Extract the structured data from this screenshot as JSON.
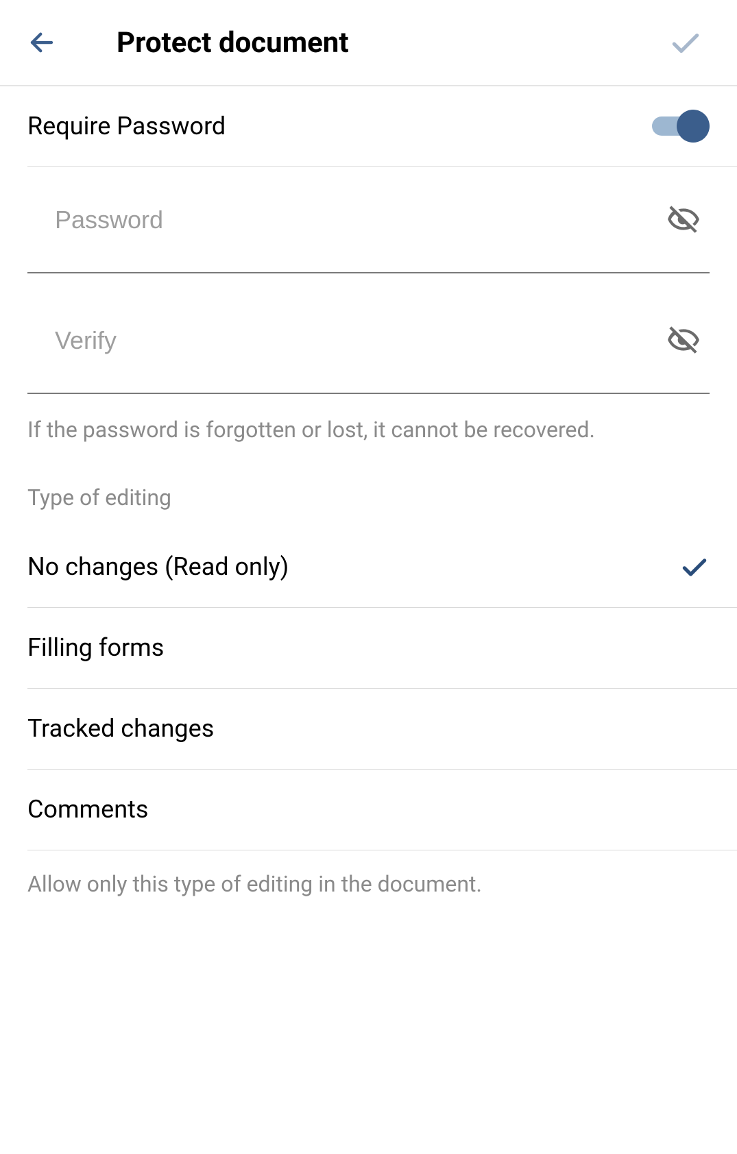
{
  "header": {
    "title": "Protect document"
  },
  "requirePassword": {
    "label": "Require Password",
    "enabled": true
  },
  "passwordField": {
    "placeholder": "Password",
    "value": ""
  },
  "verifyField": {
    "placeholder": "Verify",
    "value": ""
  },
  "passwordNote": "If the password is forgotten or lost, it cannot be recovered.",
  "editingSection": {
    "label": "Type of editing",
    "options": [
      {
        "label": "No changes (Read only)",
        "selected": true
      },
      {
        "label": "Filling forms",
        "selected": false
      },
      {
        "label": "Tracked changes",
        "selected": false
      },
      {
        "label": "Comments",
        "selected": false
      }
    ],
    "note": "Allow only this type of editing in the document."
  },
  "colors": {
    "accent": "#3b5e8c",
    "confirmCheck": "#a8b8cc"
  }
}
